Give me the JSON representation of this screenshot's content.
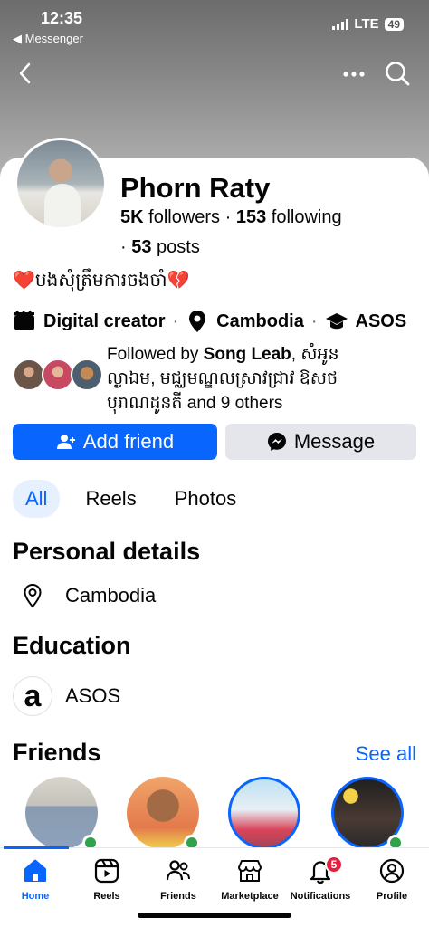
{
  "status_bar": {
    "time": "12:35",
    "back_app": "◀ Messenger",
    "network": "LTE",
    "battery": "49"
  },
  "profile": {
    "name": "Phorn Raty",
    "followers_count": "5K",
    "followers_label": "followers",
    "following_count": "153",
    "following_label": "following",
    "posts_prefix": "·",
    "posts_count": "53",
    "posts_label": "posts",
    "bio_text": "បងសុំត្រឹមការចងចាំ",
    "category": "Digital creator",
    "location": "Cambodia",
    "workplace": "ASOS",
    "separator": "·"
  },
  "mutual": {
    "prefix": "Followed by ",
    "name": "Song Leab",
    "rest": ", សំអូន ល្ងាឯម, មជ្ឈមណ្ឌលស្រាវជ្រាវ ឱសថបុរាណដូនតី and 9 others"
  },
  "actions": {
    "add_friend": "Add friend",
    "message": "Message"
  },
  "tabs": [
    "All",
    "Reels",
    "Photos"
  ],
  "personal_details": {
    "title": "Personal details",
    "location": "Cambodia"
  },
  "education": {
    "title": "Education",
    "school": "ASOS",
    "logo_letter": "a"
  },
  "friends": {
    "title": "Friends",
    "see_all": "See all"
  },
  "bottom_nav": [
    {
      "label": "Home",
      "icon": "home-icon",
      "active": true
    },
    {
      "label": "Reels",
      "icon": "reels-icon"
    },
    {
      "label": "Friends",
      "icon": "friends-icon"
    },
    {
      "label": "Marketplace",
      "icon": "marketplace-icon"
    },
    {
      "label": "Notifications",
      "icon": "bell-icon",
      "badge": "5"
    },
    {
      "label": "Profile",
      "icon": "profile-icon"
    }
  ],
  "colors": {
    "accent": "#0866ff",
    "online": "#31a24c",
    "badge": "#e41e3f"
  }
}
